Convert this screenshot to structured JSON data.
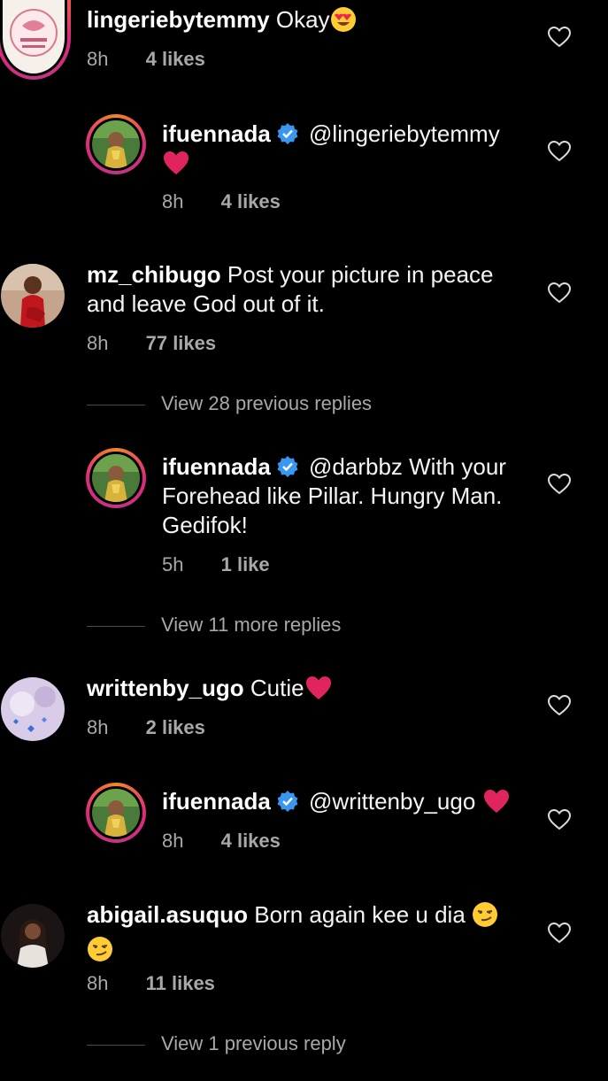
{
  "comments": [
    {
      "username": "lingeriebytemmy",
      "text": "Okay",
      "time": "8h",
      "likes": "4 likes"
    },
    {
      "username": "ifuennada",
      "text": "@lingeriebytemmy",
      "time": "8h",
      "likes": "4 likes"
    },
    {
      "username": "mz_chibugo",
      "text": "Post your picture in peace",
      "text_line2": "and leave God out of it.",
      "time": "8h",
      "likes": "77 likes"
    },
    {
      "view_replies": "View 28 previous replies"
    },
    {
      "username": "ifuennada",
      "text": "@darbbz With your",
      "text_line2": "Forehead like Pillar. Hungry Man.",
      "text_line3": "Gedifok!",
      "time": "5h",
      "likes": "1 like"
    },
    {
      "view_replies": "View 11 more replies"
    },
    {
      "username": "writtenby_ugo",
      "text": "Cutie",
      "time": "8h",
      "likes": "2 likes"
    },
    {
      "username": "ifuennada",
      "text": "@writtenby_ugo",
      "time": "8h",
      "likes": "4 likes"
    },
    {
      "username": "abigail.asuquo",
      "text": "Born again kee u dia",
      "time": "8h",
      "likes": "11 likes"
    },
    {
      "view_replies": "View 1 previous reply"
    }
  ],
  "colors": {
    "background": "#000000",
    "text": "#f5f5f5",
    "secondary": "#a8a8a8",
    "verified": "#3897f0",
    "heart_emoji": "#e0245e"
  },
  "icons": {
    "like": "heart-outline-icon",
    "verified": "verified-badge-icon",
    "emoji_heart_eyes": "smiling-face-heart-eyes-emoji",
    "emoji_red_heart": "red-heart-emoji",
    "emoji_smirk": "smirking-face-emoji"
  }
}
